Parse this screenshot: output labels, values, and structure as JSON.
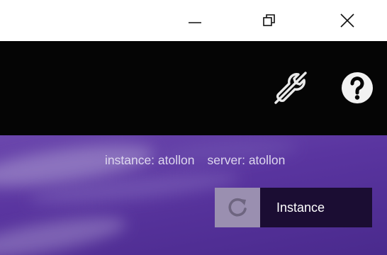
{
  "window": {
    "controls": [
      {
        "icon": "minimize-icon"
      },
      {
        "icon": "restore-icon"
      },
      {
        "icon": "close-icon"
      }
    ]
  },
  "header": {
    "icons": [
      "settings-wrench-icon",
      "help-icon"
    ],
    "background": "#050505"
  },
  "status": {
    "instance": "instance: atollon",
    "server": "server: atollon"
  },
  "instance_button": {
    "label": "Instance",
    "icon": "refresh-icon"
  },
  "colors": {
    "accent": "#5a35a0",
    "button_bg": "#1b0d33",
    "refresh_bg": "#9a8fb0"
  }
}
